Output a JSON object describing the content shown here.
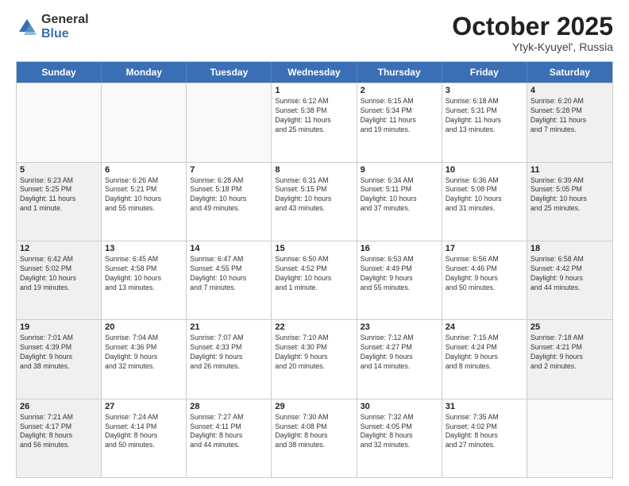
{
  "header": {
    "logo_general": "General",
    "logo_blue": "Blue",
    "month": "October 2025",
    "location": "Ytyk-Kyuyel', Russia"
  },
  "weekdays": [
    "Sunday",
    "Monday",
    "Tuesday",
    "Wednesday",
    "Thursday",
    "Friday",
    "Saturday"
  ],
  "rows": [
    [
      {
        "day": "",
        "text": ""
      },
      {
        "day": "",
        "text": ""
      },
      {
        "day": "",
        "text": ""
      },
      {
        "day": "1",
        "text": "Sunrise: 6:12 AM\nSunset: 5:38 PM\nDaylight: 11 hours\nand 25 minutes."
      },
      {
        "day": "2",
        "text": "Sunrise: 6:15 AM\nSunset: 5:34 PM\nDaylight: 11 hours\nand 19 minutes."
      },
      {
        "day": "3",
        "text": "Sunrise: 6:18 AM\nSunset: 5:31 PM\nDaylight: 11 hours\nand 13 minutes."
      },
      {
        "day": "4",
        "text": "Sunrise: 6:20 AM\nSunset: 5:28 PM\nDaylight: 11 hours\nand 7 minutes."
      }
    ],
    [
      {
        "day": "5",
        "text": "Sunrise: 6:23 AM\nSunset: 5:25 PM\nDaylight: 11 hours\nand 1 minute."
      },
      {
        "day": "6",
        "text": "Sunrise: 6:26 AM\nSunset: 5:21 PM\nDaylight: 10 hours\nand 55 minutes."
      },
      {
        "day": "7",
        "text": "Sunrise: 6:28 AM\nSunset: 5:18 PM\nDaylight: 10 hours\nand 49 minutes."
      },
      {
        "day": "8",
        "text": "Sunrise: 6:31 AM\nSunset: 5:15 PM\nDaylight: 10 hours\nand 43 minutes."
      },
      {
        "day": "9",
        "text": "Sunrise: 6:34 AM\nSunset: 5:11 PM\nDaylight: 10 hours\nand 37 minutes."
      },
      {
        "day": "10",
        "text": "Sunrise: 6:36 AM\nSunset: 5:08 PM\nDaylight: 10 hours\nand 31 minutes."
      },
      {
        "day": "11",
        "text": "Sunrise: 6:39 AM\nSunset: 5:05 PM\nDaylight: 10 hours\nand 25 minutes."
      }
    ],
    [
      {
        "day": "12",
        "text": "Sunrise: 6:42 AM\nSunset: 5:02 PM\nDaylight: 10 hours\nand 19 minutes."
      },
      {
        "day": "13",
        "text": "Sunrise: 6:45 AM\nSunset: 4:58 PM\nDaylight: 10 hours\nand 13 minutes."
      },
      {
        "day": "14",
        "text": "Sunrise: 6:47 AM\nSunset: 4:55 PM\nDaylight: 10 hours\nand 7 minutes."
      },
      {
        "day": "15",
        "text": "Sunrise: 6:50 AM\nSunset: 4:52 PM\nDaylight: 10 hours\nand 1 minute."
      },
      {
        "day": "16",
        "text": "Sunrise: 6:53 AM\nSunset: 4:49 PM\nDaylight: 9 hours\nand 55 minutes."
      },
      {
        "day": "17",
        "text": "Sunrise: 6:56 AM\nSunset: 4:46 PM\nDaylight: 9 hours\nand 50 minutes."
      },
      {
        "day": "18",
        "text": "Sunrise: 6:58 AM\nSunset: 4:42 PM\nDaylight: 9 hours\nand 44 minutes."
      }
    ],
    [
      {
        "day": "19",
        "text": "Sunrise: 7:01 AM\nSunset: 4:39 PM\nDaylight: 9 hours\nand 38 minutes."
      },
      {
        "day": "20",
        "text": "Sunrise: 7:04 AM\nSunset: 4:36 PM\nDaylight: 9 hours\nand 32 minutes."
      },
      {
        "day": "21",
        "text": "Sunrise: 7:07 AM\nSunset: 4:33 PM\nDaylight: 9 hours\nand 26 minutes."
      },
      {
        "day": "22",
        "text": "Sunrise: 7:10 AM\nSunset: 4:30 PM\nDaylight: 9 hours\nand 20 minutes."
      },
      {
        "day": "23",
        "text": "Sunrise: 7:12 AM\nSunset: 4:27 PM\nDaylight: 9 hours\nand 14 minutes."
      },
      {
        "day": "24",
        "text": "Sunrise: 7:15 AM\nSunset: 4:24 PM\nDaylight: 9 hours\nand 8 minutes."
      },
      {
        "day": "25",
        "text": "Sunrise: 7:18 AM\nSunset: 4:21 PM\nDaylight: 9 hours\nand 2 minutes."
      }
    ],
    [
      {
        "day": "26",
        "text": "Sunrise: 7:21 AM\nSunset: 4:17 PM\nDaylight: 8 hours\nand 56 minutes."
      },
      {
        "day": "27",
        "text": "Sunrise: 7:24 AM\nSunset: 4:14 PM\nDaylight: 8 hours\nand 50 minutes."
      },
      {
        "day": "28",
        "text": "Sunrise: 7:27 AM\nSunset: 4:11 PM\nDaylight: 8 hours\nand 44 minutes."
      },
      {
        "day": "29",
        "text": "Sunrise: 7:30 AM\nSunset: 4:08 PM\nDaylight: 8 hours\nand 38 minutes."
      },
      {
        "day": "30",
        "text": "Sunrise: 7:32 AM\nSunset: 4:05 PM\nDaylight: 8 hours\nand 32 minutes."
      },
      {
        "day": "31",
        "text": "Sunrise: 7:35 AM\nSunset: 4:02 PM\nDaylight: 8 hours\nand 27 minutes."
      },
      {
        "day": "",
        "text": ""
      }
    ]
  ]
}
